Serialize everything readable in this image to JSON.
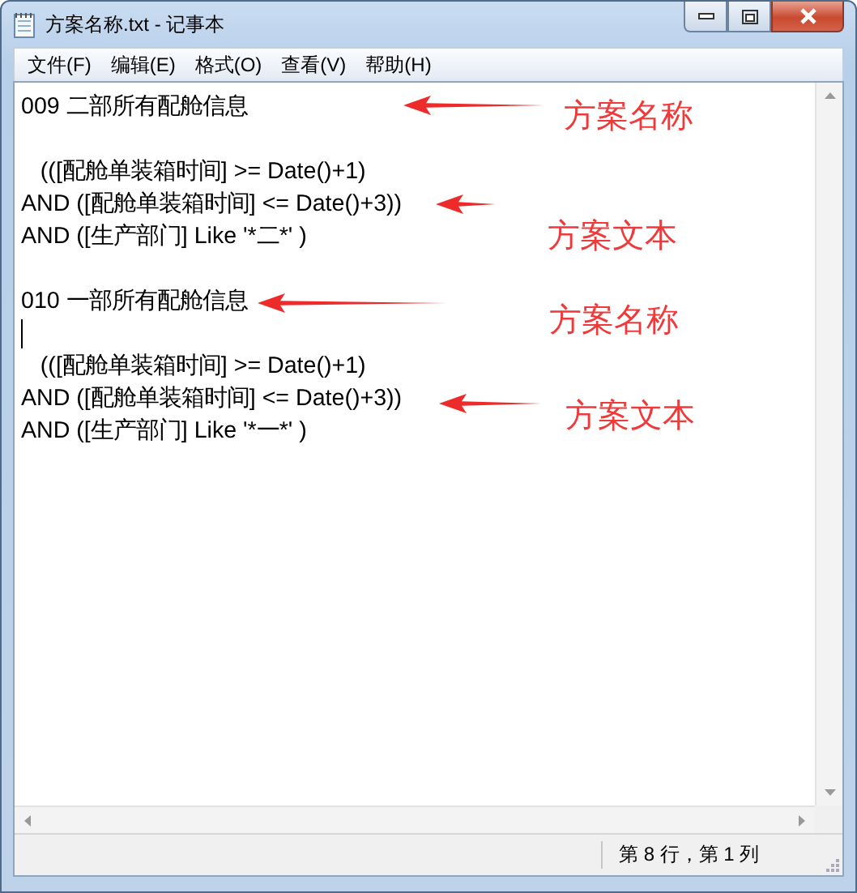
{
  "window": {
    "title": "方案名称.txt - 记事本"
  },
  "menu": [
    {
      "label": "文件(F)"
    },
    {
      "label": "编辑(E)"
    },
    {
      "label": "格式(O)"
    },
    {
      "label": "查看(V)"
    },
    {
      "label": "帮助(H)"
    }
  ],
  "lines": [
    {
      "kind": "text",
      "text": "009 二部所有配舱信息"
    },
    {
      "kind": "blank"
    },
    {
      "kind": "text",
      "text": "   (([配舱单装箱时间] >= Date()+1)"
    },
    {
      "kind": "text",
      "text": "AND ([配舱单装箱时间] <= Date()+3))"
    },
    {
      "kind": "text",
      "text": "AND ([生产部门] Like '*二*' )"
    },
    {
      "kind": "blank"
    },
    {
      "kind": "text",
      "text": "010 一部所有配舱信息"
    },
    {
      "kind": "caret"
    },
    {
      "kind": "text",
      "text": "   (([配舱单装箱时间] >= Date()+1)"
    },
    {
      "kind": "text",
      "text": "AND ([配舱单装箱时间] <= Date()+3))"
    },
    {
      "kind": "text",
      "text": "AND ([生产部门] Like '*一*' )"
    }
  ],
  "annotations": [
    {
      "text": "方案名称"
    },
    {
      "text": "方案文本"
    },
    {
      "text": "方案名称"
    },
    {
      "text": "方案文本"
    }
  ],
  "status_bar": {
    "position": "第 8 行，第 1 列"
  }
}
